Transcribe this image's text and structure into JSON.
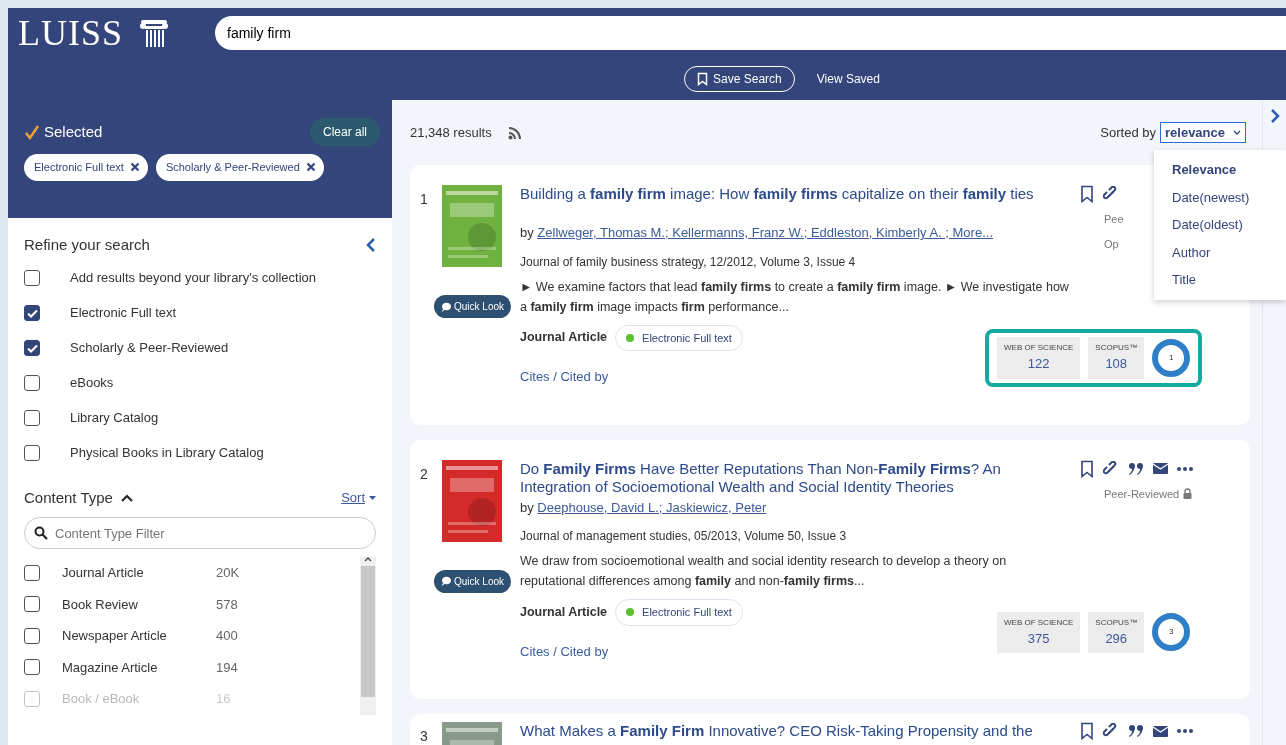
{
  "header": {
    "logo": "LUISS",
    "search_value": "family firm",
    "save_search": "Save Search",
    "view_saved": "View Saved"
  },
  "selected": {
    "title": "Selected",
    "clear_all": "Clear all",
    "chips": [
      "Electronic Full text",
      "Scholarly & Peer-Reviewed"
    ]
  },
  "refine": {
    "title": "Refine your search",
    "options": [
      {
        "label": "Add results beyond your library's collection",
        "checked": false
      },
      {
        "label": "Electronic Full text",
        "checked": true
      },
      {
        "label": "Scholarly & Peer-Reviewed",
        "checked": true
      },
      {
        "label": "eBooks",
        "checked": false
      },
      {
        "label": "Library Catalog",
        "checked": false
      },
      {
        "label": "Physical Books in Library Catalog",
        "checked": false
      }
    ]
  },
  "content_type": {
    "title": "Content Type",
    "expanded": true,
    "sort": "Sort",
    "filter_placeholder": "Content Type Filter",
    "items": [
      {
        "label": "Journal Article",
        "count": "20K",
        "checked": false
      },
      {
        "label": "Book Review",
        "count": "578",
        "checked": false
      },
      {
        "label": "Newspaper Article",
        "count": "400",
        "checked": false
      },
      {
        "label": "Magazine Article",
        "count": "194",
        "checked": false
      },
      {
        "label": "Book / eBook",
        "count": "16",
        "checked": false
      }
    ]
  },
  "results_bar": {
    "count": "21,348 results",
    "sorted_by": "Sorted by",
    "sort_value": "relevance",
    "sort_menu": [
      {
        "label": "Relevance",
        "selected": true
      },
      {
        "label": "Date(newest)",
        "selected": false
      },
      {
        "label": "Date(oldest)",
        "selected": false
      },
      {
        "label": "Author",
        "selected": false
      },
      {
        "label": "Title",
        "selected": false
      }
    ]
  },
  "results": [
    {
      "number": "1",
      "cover": {
        "color": "#6fb23f"
      },
      "title": "Building a **family firm** image: How **family firms** capitalize on their **family** ties",
      "by": "by",
      "authors": "Zellweger, Thomas M.; Kellermanns, Franz W.; Eddleston, Kimberly A. ; More...",
      "source": "Journal of family business strategy, 12/2012, Volume 3, Issue 4",
      "abstract": "► We examine factors that lead **family firms** to create a **family firm** image. ► We investigate how a **family firm** image impacts **firm** performance...",
      "quick_look": "Quick Look",
      "type": "Journal Article",
      "availability": "Electronic Full text",
      "cites": "Cites / Cited by",
      "actions": [
        {
          "kind": "bookmark"
        },
        {
          "kind": "link"
        }
      ],
      "badges": [
        {
          "text": "Pee",
          "lock": false
        },
        {
          "text": "Op",
          "lock": false
        }
      ],
      "metrics": {
        "wos_label": "WEB OF SCIENCE",
        "wos": "122",
        "scopus_label": "SCOPUS™",
        "scopus": "108",
        "altmetric": "1",
        "highlighted": true
      }
    },
    {
      "number": "2",
      "cover": {
        "color": "#d42a2a"
      },
      "title": "Do **Family Firms** Have Better Reputations Than Non-**Family Firms**? An Integration of Socioemotional Wealth and Social Identity Theories",
      "by": "by",
      "authors": "Deephouse, David L.; Jaskiewicz, Peter",
      "source": "Journal of management studies, 05/2013, Volume 50, Issue 3",
      "abstract": "We draw from socioemotional wealth and social identity research to develop a theory on reputational differences among **family** and non-**family firms**...",
      "quick_look": "Quick Look",
      "type": "Journal Article",
      "availability": "Electronic Full text",
      "cites": "Cites / Cited by",
      "actions": [
        {
          "kind": "bookmark"
        },
        {
          "kind": "link"
        },
        {
          "kind": "quote"
        },
        {
          "kind": "mail"
        },
        {
          "kind": "more"
        }
      ],
      "badges": [
        {
          "text": "Peer-Reviewed",
          "lock": true
        }
      ],
      "metrics": {
        "wos_label": "WEB OF SCIENCE",
        "wos": "375",
        "scopus_label": "SCOPUS™",
        "scopus": "296",
        "altmetric": "3",
        "highlighted": false
      }
    },
    {
      "number": "3",
      "cover": {
        "color": "#8a9a8a"
      },
      "title": "What Makes a **Family Firm** Innovative? CEO Risk-Taking Propensity and the",
      "actions": [
        {
          "kind": "bookmark"
        },
        {
          "kind": "link"
        },
        {
          "kind": "quote"
        },
        {
          "kind": "mail"
        },
        {
          "kind": "more"
        }
      ]
    }
  ]
}
